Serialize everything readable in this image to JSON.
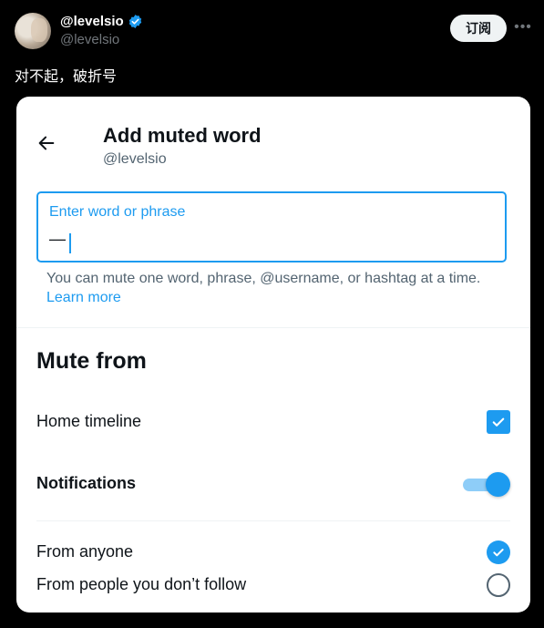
{
  "tweet": {
    "display_name": "@levelsio",
    "handle": "@levelsio",
    "subscribe_label": "订阅",
    "more_icon": "more-horizontal-icon",
    "text": "对不起，破折号"
  },
  "card": {
    "title": "Add muted word",
    "subtitle": "@levelsio",
    "word_field": {
      "label": "Enter word or phrase",
      "value": "—"
    },
    "help_text": "You can mute one word, phrase, @username, or hashtag at a time.",
    "learn_more": "Learn more",
    "mute_from": {
      "heading": "Mute from",
      "home_timeline": {
        "label": "Home timeline",
        "checked": true
      },
      "notifications": {
        "label": "Notifications",
        "enabled": true
      },
      "from_anyone": {
        "label": "From anyone",
        "selected": true
      },
      "from_not_following": {
        "label": "From people you don’t follow",
        "selected": false
      }
    }
  },
  "colors": {
    "accent": "#1d9bf0",
    "background": "#000000",
    "card": "#ffffff"
  }
}
